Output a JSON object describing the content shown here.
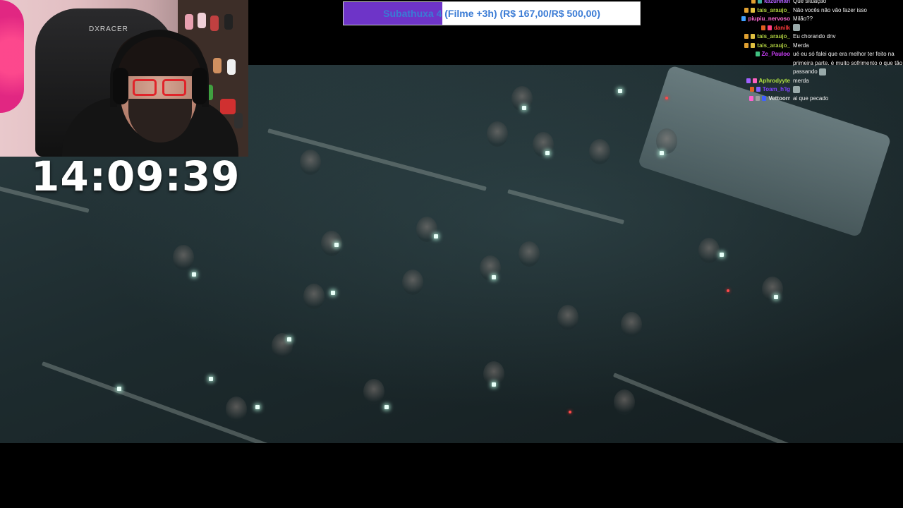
{
  "subathon": {
    "label": "Subathuxa 4 (Filme +3h) (R$ 167,00/R$ 500,00)",
    "progress_fraction": 0.334,
    "fill_color": "#6e34c8",
    "text_color": "#3a7bd5"
  },
  "timer": {
    "value": "14:09:39"
  },
  "webcam": {
    "chair_brand": "DXRACER"
  },
  "chat": {
    "messages": [
      {
        "user": "kazuhhan",
        "user_color": "#b060ff",
        "text": "Que situação",
        "badges": [
          "#e0a030",
          "#40b0a0"
        ]
      },
      {
        "user": "tais_araujo_",
        "user_color": "#b0d040",
        "text": "Não vocês não vão fazer isso",
        "badges": [
          "#e0a030",
          "#e0c040"
        ]
      },
      {
        "user": "piupiu_nervoso",
        "user_color": "#ff6ad5",
        "text": "Milão??",
        "badges": [
          "#3fa0ff"
        ]
      },
      {
        "user": "danilk",
        "user_color": "#ff3b3b",
        "text": "",
        "emote": "emote",
        "badges": [
          "#e06020",
          "#ff4080"
        ]
      },
      {
        "user": "tais_araujo_",
        "user_color": "#b0d040",
        "text": "Eu chorando dnv",
        "badges": [
          "#e0a030",
          "#e0c040"
        ]
      },
      {
        "user": "tais_araujo_",
        "user_color": "#b0d040",
        "text": "Merda",
        "badges": [
          "#e0a030",
          "#e0c040"
        ]
      },
      {
        "user": "Ze_Pauloo",
        "user_color": "#d040ff",
        "text": "ué eu só falei que era melhor ter feito na primeira parte. é muito sofrimento o que tão passando",
        "emote": "emote",
        "badges": [
          "#40c080"
        ]
      },
      {
        "user": "Aphrodyyte",
        "user_color": "#b0e040",
        "text": "merda",
        "badges": [
          "#a060ff",
          "#ff60c0"
        ]
      },
      {
        "user": "Toam_h'Ig",
        "user_color": "#8040ff",
        "text": "",
        "emote": "emote",
        "badges": [
          "#e06020",
          "#8060ff"
        ]
      },
      {
        "user": "Vettoorr",
        "user_color": "#e8e8e8",
        "text": "ai que pecado",
        "badges": [
          "#ff60d0",
          "#a0a0a0",
          "#4060ff"
        ]
      }
    ]
  }
}
